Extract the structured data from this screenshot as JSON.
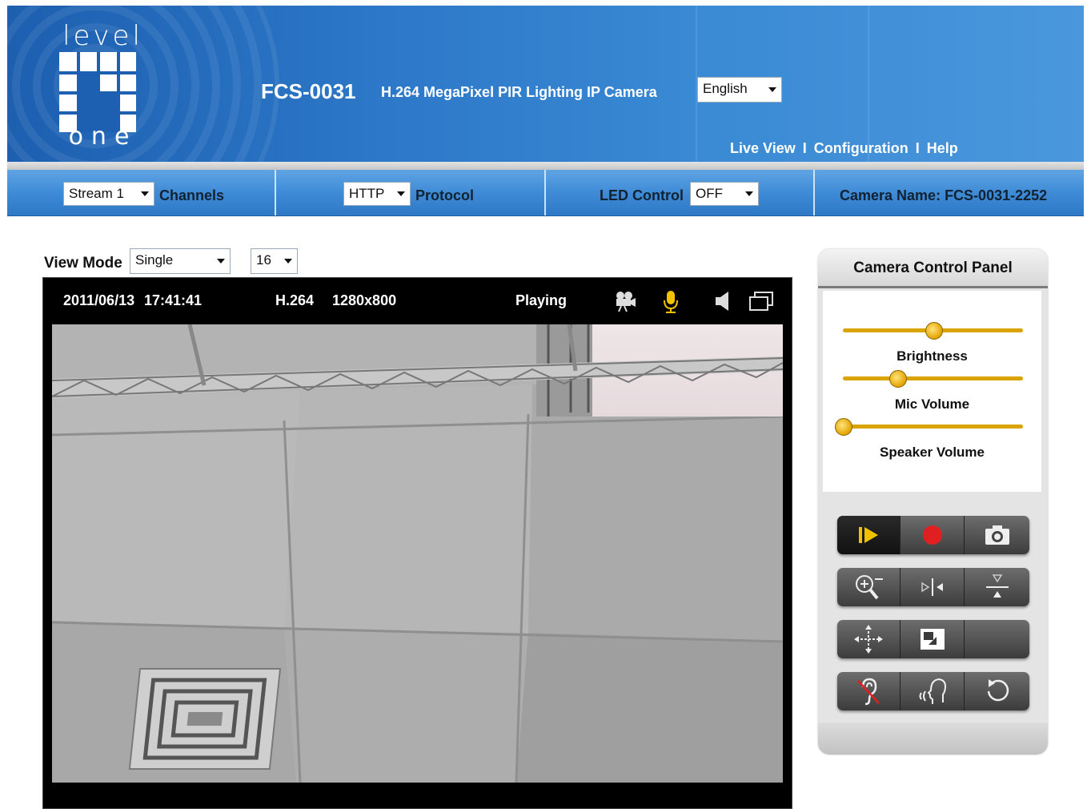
{
  "header": {
    "logo": {
      "top": "level",
      "bottom": "one"
    },
    "model": "FCS-0031",
    "product": "H.264 MegaPixel PIR Lighting IP Camera",
    "language": "English",
    "nav": {
      "live_view": "Live View",
      "sep": "I",
      "configuration": "Configuration",
      "help": "Help"
    }
  },
  "bar": {
    "stream": {
      "value": "Stream 1",
      "label": "Channels"
    },
    "protocol": {
      "value": "HTTP",
      "label": "Protocol"
    },
    "led": {
      "label": "LED Control",
      "value": "OFF"
    },
    "camera_name": "Camera Name: FCS-0031-2252"
  },
  "view_mode": {
    "label": "View Mode",
    "mode": "Single",
    "count": "16"
  },
  "video": {
    "date": "2011/06/13",
    "time": "17:41:41",
    "codec": "H.264",
    "resolution": "1280x800",
    "status": "Playing",
    "icons": [
      "video-camera-icon",
      "microphone-icon",
      "speaker-icon",
      "multi-window-icon"
    ]
  },
  "control_panel": {
    "title": "Camera Control Panel",
    "sliders": [
      {
        "label": "Brightness",
        "level": 0.5
      },
      {
        "label": "Mic Volume",
        "level": 0.3
      },
      {
        "label": "Speaker Volume",
        "level": 0.0
      }
    ],
    "buttons": [
      [
        "play-icon",
        "record-icon",
        "snapshot-icon"
      ],
      [
        "zoom-icon",
        "flip-horizontal-icon",
        "flip-vertical-icon"
      ],
      [
        "pan-icon",
        "window-icon",
        "blank"
      ],
      [
        "mute-listen-icon",
        "talk-icon",
        "reset-icon"
      ]
    ]
  },
  "colors": {
    "header_blue": "#2d78c8",
    "bar_blue": "#3f8bd6",
    "knob": "#e3a300",
    "record_red": "#e02020",
    "play_yellow": "#f2c200"
  }
}
